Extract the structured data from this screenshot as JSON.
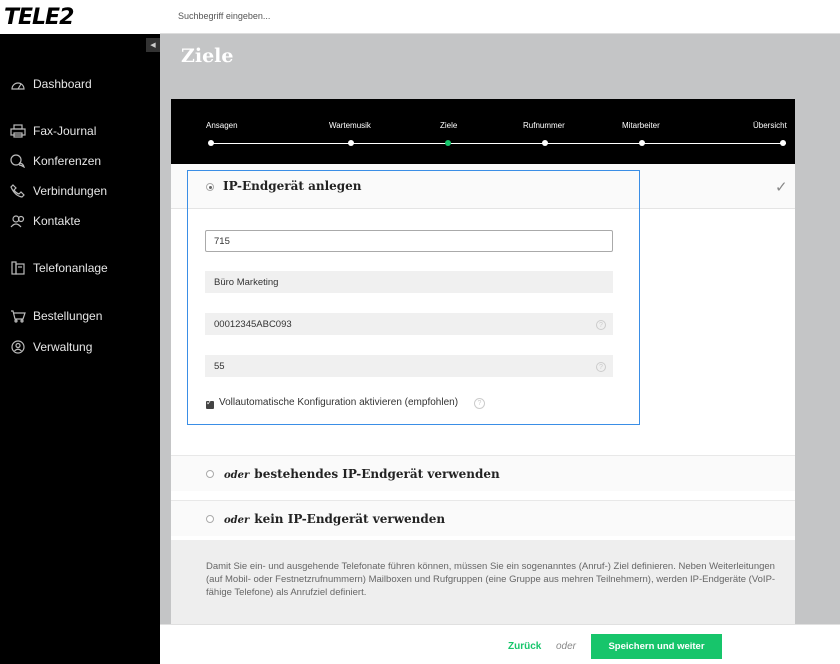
{
  "brand": {
    "logo_text": "TELE2"
  },
  "sidebar": {
    "items": [
      {
        "label": "Dashboard",
        "icon": "dashboard-icon"
      },
      {
        "label": "Fax-Journal",
        "icon": "printer-icon"
      },
      {
        "label": "Konferenzen",
        "icon": "chat-icon"
      },
      {
        "label": "Verbindungen",
        "icon": "phone-icon"
      },
      {
        "label": "Kontakte",
        "icon": "contacts-icon"
      },
      {
        "label": "Telefonanlage",
        "icon": "phone-system-icon"
      },
      {
        "label": "Bestellungen",
        "icon": "cart-icon"
      },
      {
        "label": "Verwaltung",
        "icon": "user-circle-icon"
      }
    ]
  },
  "search": {
    "placeholder": "Suchbegriff eingeben..."
  },
  "page": {
    "title": "Ziele"
  },
  "stepper": {
    "steps": [
      "Ansagen",
      "Wartemusik",
      "Ziele",
      "Rufnummer",
      "Mitarbeiter",
      "Übersicht"
    ],
    "active_step": "Ziele",
    "active_color": "#17c56b"
  },
  "form": {
    "section_title": "IP-Endgerät anlegen",
    "fields": {
      "extension": "715",
      "name": "Büro Marketing",
      "mac_address": "00012345ABC093",
      "pin": "55"
    },
    "auto_config_label": "Vollautomatische Konfiguration aktivieren (empfohlen)",
    "auto_config_checked": true
  },
  "options": {
    "existing": {
      "prefix": "oder",
      "label": "bestehendes IP-Endgerät verwenden"
    },
    "none": {
      "prefix": "oder",
      "label": "kein IP-Endgerät verwenden"
    }
  },
  "info": {
    "text": "Damit Sie ein- und ausgehende Telefonate führen können, müssen Sie ein sogenanntes (Anruf-) Ziel definieren. Neben Weiterleitungen (auf Mobil- oder Festnetzrufnummern) Mailboxen und Rufgruppen (eine Gruppe aus mehren Teilnehmern), werden IP-Endgeräte (VoIP-fähige Telefone) als Anrufziel definiert."
  },
  "footer": {
    "back_label": "Zurück",
    "oder_label": "oder",
    "save_label": "Speichern und weiter"
  }
}
